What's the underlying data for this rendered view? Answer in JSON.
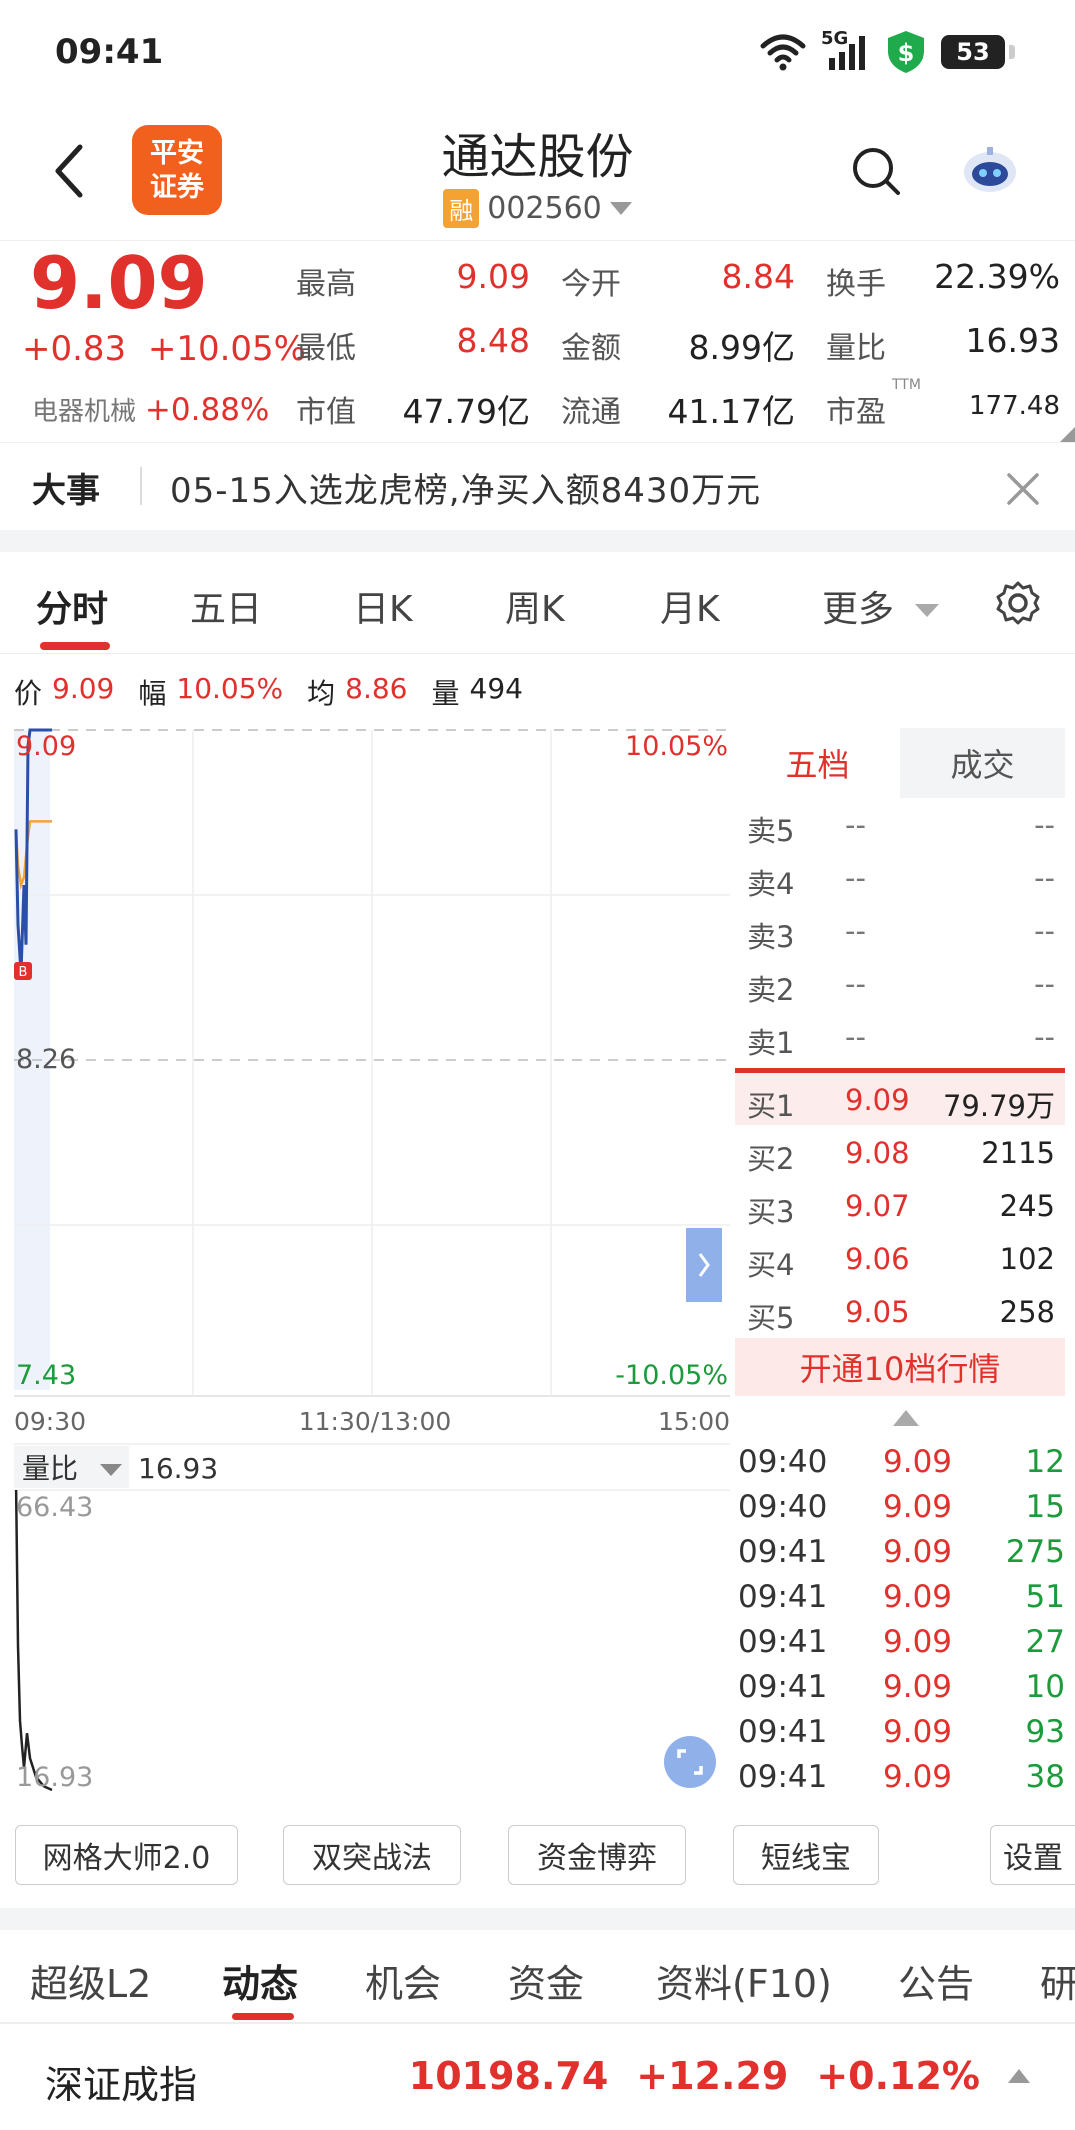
{
  "status_bar": {
    "time": "09:41",
    "network": "5G",
    "battery": "53"
  },
  "header": {
    "broker_logo_line1": "平安",
    "broker_logo_line2": "证券",
    "stock_name": "通达股份",
    "badge": "融",
    "stock_code": "002560"
  },
  "quote": {
    "price": "9.09",
    "change": "+0.83",
    "change_pct": "+10.05%",
    "sector_name": "电器机械",
    "sector_change": "+0.88%",
    "stats": [
      {
        "label": "最高",
        "value": "9.09",
        "color": "red"
      },
      {
        "label": "今开",
        "value": "8.84",
        "color": "red"
      },
      {
        "label": "换手",
        "value": "22.39%",
        "color": "dark"
      },
      {
        "label": "最低",
        "value": "8.48",
        "color": "red"
      },
      {
        "label": "金额",
        "value": "8.99亿",
        "color": "dark"
      },
      {
        "label": "量比",
        "value": "16.93",
        "color": "dark"
      },
      {
        "label": "市值",
        "value": "47.79亿",
        "color": "dark"
      },
      {
        "label": "流通",
        "value": "41.17亿",
        "color": "dark"
      },
      {
        "label": "市盈",
        "value": "177.48",
        "color": "dark"
      }
    ],
    "ttm": "TTM"
  },
  "event": {
    "label": "大事",
    "text": "05-15入选龙虎榜,净买入额8430万元"
  },
  "period_tabs": [
    "分时",
    "五日",
    "日K",
    "周K",
    "月K",
    "更多"
  ],
  "chart_info": {
    "price_label": "价",
    "price": "9.09",
    "amp_label": "幅",
    "amp": "10.05%",
    "avg_label": "均",
    "avg": "8.86",
    "vol_label": "量",
    "vol": "494"
  },
  "chart_data": {
    "type": "line",
    "y_top_label": "9.09",
    "y_mid_label": "8.26",
    "y_bottom_label": "7.43",
    "pct_top_label": "10.05%",
    "pct_bottom_label": "-10.05%",
    "x_labels": [
      "09:30",
      "11:30/13:00",
      "15:00"
    ],
    "ylim": [
      7.43,
      9.09
    ],
    "price_series": [
      8.84,
      8.6,
      8.48,
      8.7,
      8.55,
      9.05,
      9.09,
      9.09,
      9.09
    ],
    "avg_series": [
      8.84,
      8.75,
      8.7,
      8.72,
      8.8,
      8.86,
      8.86,
      8.86,
      8.86
    ],
    "marker": "B",
    "volume_ratio_label": "量比",
    "volume_ratio_value": "16.93",
    "vr_top_label": "66.43",
    "vr_bottom_label": "16.93",
    "vr_ylim": [
      16.93,
      66.43
    ],
    "vr_series": [
      66.43,
      40.0,
      28.0,
      24.0,
      20.5,
      26.0,
      22.0,
      19.0,
      17.5,
      16.93
    ]
  },
  "order_book": {
    "tabs": [
      "五档",
      "成交"
    ],
    "sell": [
      {
        "label": "卖5",
        "price": "--",
        "vol": "--"
      },
      {
        "label": "卖4",
        "price": "--",
        "vol": "--"
      },
      {
        "label": "卖3",
        "price": "--",
        "vol": "--"
      },
      {
        "label": "卖2",
        "price": "--",
        "vol": "--"
      },
      {
        "label": "卖1",
        "price": "--",
        "vol": "--"
      }
    ],
    "buy": [
      {
        "label": "买1",
        "price": "9.09",
        "vol": "79.79万"
      },
      {
        "label": "买2",
        "price": "9.08",
        "vol": "2115"
      },
      {
        "label": "买3",
        "price": "9.07",
        "vol": "245"
      },
      {
        "label": "买4",
        "price": "9.06",
        "vol": "102"
      },
      {
        "label": "买5",
        "price": "9.05",
        "vol": "258"
      }
    ],
    "upgrade": "开通10档行情"
  },
  "trades": [
    {
      "time": "09:40",
      "price": "9.09",
      "vol": "12"
    },
    {
      "time": "09:40",
      "price": "9.09",
      "vol": "15"
    },
    {
      "time": "09:41",
      "price": "9.09",
      "vol": "275"
    },
    {
      "time": "09:41",
      "price": "9.09",
      "vol": "51"
    },
    {
      "time": "09:41",
      "price": "9.09",
      "vol": "27"
    },
    {
      "time": "09:41",
      "price": "9.09",
      "vol": "10"
    },
    {
      "time": "09:41",
      "price": "9.09",
      "vol": "93"
    },
    {
      "time": "09:41",
      "price": "9.09",
      "vol": "38"
    }
  ],
  "tools": [
    "网格大师2.0",
    "双突战法",
    "资金博弈",
    "短线宝",
    "设置"
  ],
  "bottom_tabs": [
    "超级L2",
    "动态",
    "机会",
    "资金",
    "资料(F10)",
    "公告",
    "研"
  ],
  "index_bar": {
    "name": "深证成指",
    "value": "10198.74",
    "change": "+12.29",
    "pct": "+0.12%"
  },
  "colors": {
    "up": "#e0312d",
    "down": "#1b9b3b",
    "avg_line": "#f2a33a",
    "price_line": "#2a4fa8"
  }
}
